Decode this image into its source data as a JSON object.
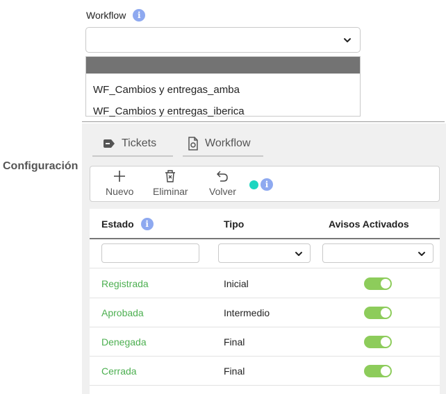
{
  "workflow": {
    "label": "Workflow",
    "selected_value": "",
    "options": [
      "",
      "WF_Cambios y entregas_amba",
      "WF_Cambios y entregas_iberica"
    ]
  },
  "section": {
    "title": "Configuración"
  },
  "tabs": [
    {
      "label": "Tickets",
      "icon": "tag-icon"
    },
    {
      "label": "Workflow",
      "icon": "document-gear-icon"
    }
  ],
  "toolbar": {
    "new_label": "Nuevo",
    "delete_label": "Eliminar",
    "back_label": "Volver",
    "status_color": "#1dd6c0"
  },
  "grid": {
    "columns": [
      "Estado",
      "Tipo",
      "Avisos Activados"
    ],
    "filters": {
      "estado": "",
      "tipo": "",
      "avisos": ""
    },
    "rows": [
      {
        "estado": "Registrada",
        "tipo": "Inicial",
        "avisos": true
      },
      {
        "estado": "Aprobada",
        "tipo": "Intermedio",
        "avisos": true
      },
      {
        "estado": "Denegada",
        "tipo": "Final",
        "avisos": true
      },
      {
        "estado": "Cerrada",
        "tipo": "Final",
        "avisos": true
      }
    ]
  },
  "colors": {
    "accent_green": "#4caf50",
    "toggle_on": "#8dcc5b",
    "info_blue": "#8ea9f0",
    "selected_option": "#737373"
  }
}
